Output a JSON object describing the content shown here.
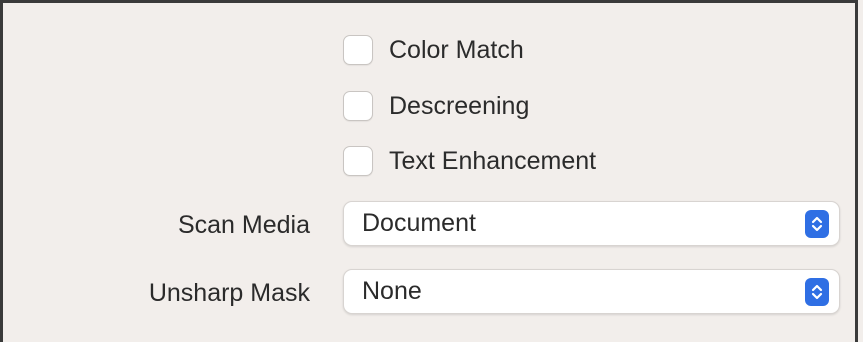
{
  "options": {
    "checkboxes": [
      {
        "label": "Color Match",
        "checked": false
      },
      {
        "label": "Descreening",
        "checked": false
      },
      {
        "label": "Text Enhancement",
        "checked": false
      }
    ]
  },
  "fields": {
    "scan_media": {
      "label": "Scan Media",
      "value": "Document"
    },
    "unsharp_mask": {
      "label": "Unsharp Mask",
      "value": "None"
    }
  },
  "colors": {
    "accent": "#2f6fe4",
    "background": "#f2eeeb"
  }
}
